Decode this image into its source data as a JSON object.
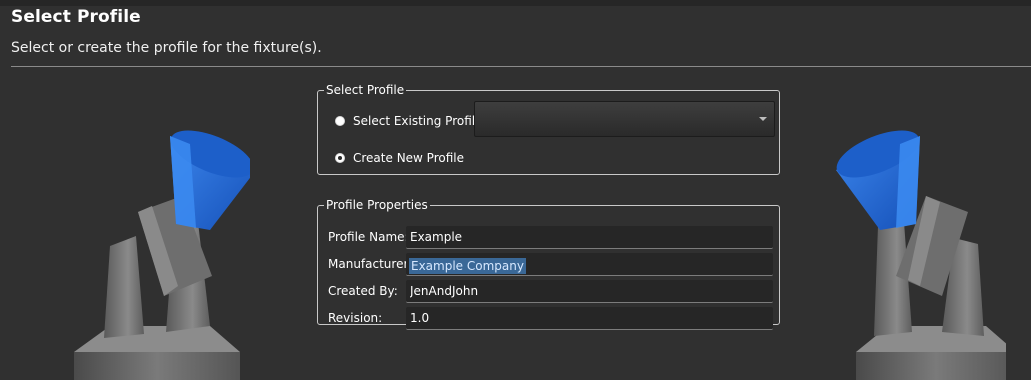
{
  "header": {
    "title": "Select Profile",
    "subtitle": "Select or create the profile for the fixture(s)."
  },
  "select_profile": {
    "legend": "Select Profile",
    "existing_option_label": "Select Existing Profile",
    "existing_selected": false,
    "dropdown_value": "",
    "new_option_label": "Create New Profile",
    "new_selected": true
  },
  "profile_properties": {
    "legend": "Profile Properties",
    "fields": [
      {
        "label": "Profile Name:",
        "value": "Example"
      },
      {
        "label": "Manufacturer:",
        "value": "Example Company",
        "text_selected": true
      },
      {
        "label": "Created By:",
        "value": "JenAndJohn"
      },
      {
        "label": "Revision:",
        "value": "1.0"
      }
    ]
  },
  "decorations": {
    "left_fixture": "moving-head-light-icon",
    "right_fixture": "moving-head-light-icon",
    "cone_color": "#1f66d1",
    "body_color": "#6b6b6b"
  }
}
